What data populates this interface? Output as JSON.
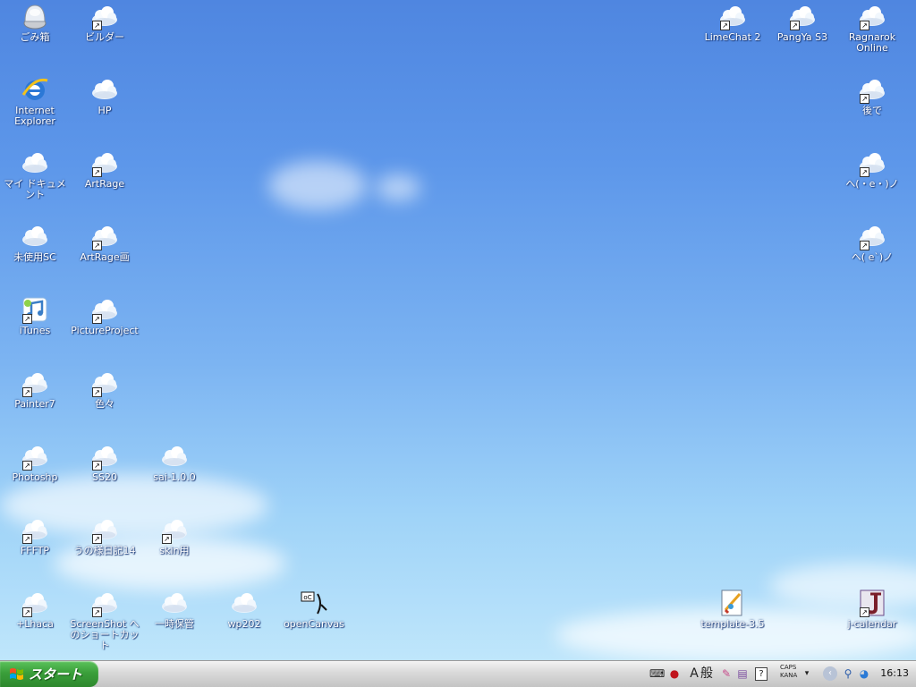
{
  "desktop": {
    "icons": [
      {
        "id": "recycle-bin",
        "label": "ごみ箱",
        "shortcut": false,
        "kind": "trash"
      },
      {
        "id": "builder",
        "label": "ビルダー",
        "shortcut": true,
        "kind": "cloud"
      },
      {
        "id": "internet-explorer",
        "label": "Internet Explorer",
        "shortcut": false,
        "kind": "ie"
      },
      {
        "id": "hp",
        "label": "HP",
        "shortcut": false,
        "kind": "cloud"
      },
      {
        "id": "my-documents",
        "label": "マイ ドキュメント",
        "shortcut": false,
        "kind": "cloud"
      },
      {
        "id": "artrage",
        "label": "ArtRage",
        "shortcut": true,
        "kind": "cloud"
      },
      {
        "id": "unused-sc",
        "label": "未使用SC",
        "shortcut": false,
        "kind": "cloud"
      },
      {
        "id": "artrage-ga",
        "label": "ArtRage画",
        "shortcut": true,
        "kind": "cloud"
      },
      {
        "id": "itunes",
        "label": "iTunes",
        "shortcut": true,
        "kind": "itunes"
      },
      {
        "id": "pictureproject",
        "label": "PictureProject",
        "shortcut": true,
        "kind": "cloud"
      },
      {
        "id": "painter7",
        "label": "Painter7",
        "shortcut": true,
        "kind": "cloud"
      },
      {
        "id": "iroiro",
        "label": "色々",
        "shortcut": true,
        "kind": "cloud"
      },
      {
        "id": "photoshop",
        "label": "Photoshp",
        "shortcut": true,
        "kind": "cloud"
      },
      {
        "id": "ss20",
        "label": "SS20",
        "shortcut": true,
        "kind": "cloud"
      },
      {
        "id": "sai",
        "label": "sai-1.0.0",
        "shortcut": false,
        "kind": "cloud"
      },
      {
        "id": "ffftp",
        "label": "FFFTP",
        "shortcut": true,
        "kind": "cloud"
      },
      {
        "id": "nikki",
        "label": "うの様日記14",
        "shortcut": true,
        "kind": "cloud"
      },
      {
        "id": "skin",
        "label": "skin用",
        "shortcut": true,
        "kind": "cloud"
      },
      {
        "id": "fluxaca",
        "label": "+Lhaca",
        "shortcut": true,
        "kind": "cloud"
      },
      {
        "id": "screenshot",
        "label": "ScreenShot へのショートカット",
        "shortcut": true,
        "kind": "cloud"
      },
      {
        "id": "ichiji",
        "label": "一時保管",
        "shortcut": false,
        "kind": "cloud"
      },
      {
        "id": "wp202",
        "label": "wp202",
        "shortcut": false,
        "kind": "cloud"
      },
      {
        "id": "opencanvas",
        "label": "openCanvas",
        "shortcut": false,
        "kind": "oc"
      },
      {
        "id": "limechat",
        "label": "LimeChat 2",
        "shortcut": true,
        "kind": "cloud"
      },
      {
        "id": "pangya",
        "label": "PangYa S3",
        "shortcut": true,
        "kind": "cloud"
      },
      {
        "id": "ragnarok",
        "label": "Ragnarok Online",
        "shortcut": true,
        "kind": "cloud"
      },
      {
        "id": "atode",
        "label": "後で",
        "shortcut": true,
        "kind": "cloud"
      },
      {
        "id": "face1",
        "label": "へ(・e・)ノ",
        "shortcut": true,
        "kind": "cloud"
      },
      {
        "id": "face2",
        "label": "へ( e`)ノ",
        "shortcut": true,
        "kind": "cloud"
      },
      {
        "id": "template",
        "label": "template-3.5",
        "shortcut": false,
        "kind": "template"
      },
      {
        "id": "jcalendar",
        "label": "j-calendar",
        "shortcut": true,
        "kind": "jcal"
      }
    ]
  },
  "taskbar": {
    "start_label": "スタート",
    "ime_mode": "A",
    "ime_kanji": "般",
    "caps": "CAPS",
    "kana": "KANA",
    "clock": "16:13"
  },
  "colors": {
    "desktop_top": "#4f86e0",
    "desktop_bottom": "#bfe6fb",
    "start_green": "#3a9f3a",
    "taskbar_gray": "#d9d9d9"
  }
}
